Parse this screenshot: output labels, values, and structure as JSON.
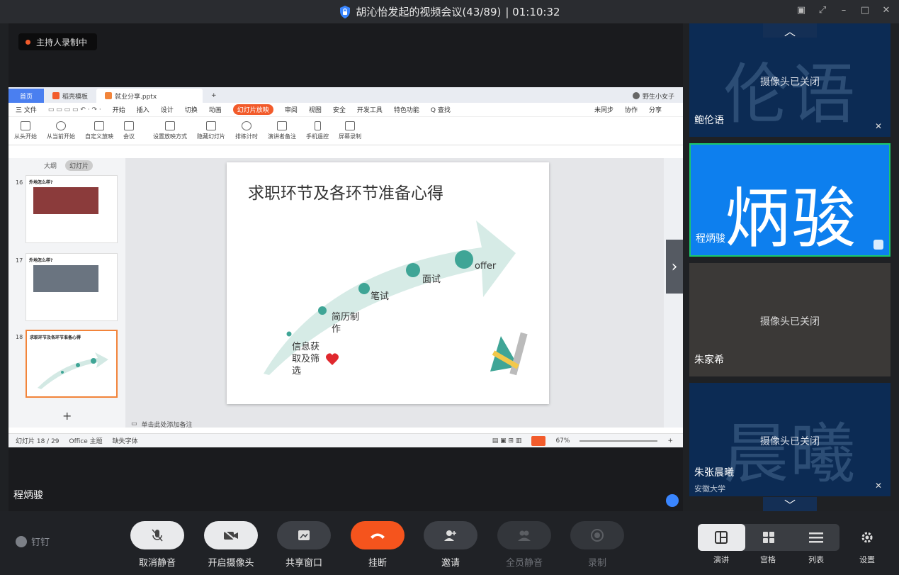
{
  "window": {
    "title": "胡沁怡发起的视频会议(43/89)",
    "timer": "| 01:10:32"
  },
  "recording_badge": "主持人录制中",
  "main_speaker": "程炳骏",
  "wps": {
    "tabs": [
      "首页",
      "稻壳模板",
      "就业分享.pptx"
    ],
    "menu": [
      "三 文件",
      "开始",
      "插入",
      "设计",
      "切换",
      "动画",
      "幻灯片放映",
      "审阅",
      "视图",
      "安全",
      "开发工具",
      "特色功能",
      "Q 查找"
    ],
    "menu_right": [
      "未同步",
      "协作",
      "分享"
    ],
    "ribbon": [
      "从头开始",
      "从当前开始",
      "自定义放映",
      "会议",
      "设置放映方式",
      "隐藏幻灯片",
      "排练计时",
      "演讲者备注",
      "手机遥控",
      "屏幕录制"
    ],
    "user": "野生小女子",
    "panel_tabs": [
      "大纲",
      "幻灯片"
    ],
    "thumbs": [
      {
        "num": "16",
        "title": "外地怎么样?"
      },
      {
        "num": "17",
        "title": "外地怎么样?"
      },
      {
        "num": "18",
        "title": "求职环节及各环节准备心得"
      }
    ],
    "notes_placeholder": "单击此处添加备注",
    "status_left": "幻灯片 18 / 29",
    "status_theme": "Office 主题",
    "status_font": "缺失字体",
    "zoom": "67%"
  },
  "slide": {
    "title": "求职环节及各环节准备心得",
    "steps": [
      "信息获取及筛选",
      "简历制作",
      "笔试",
      "面试",
      "offer"
    ]
  },
  "participants": [
    {
      "bg_text": "伦语",
      "camera": "摄像头已关闭",
      "name": "鲍伦语",
      "style": "dark"
    },
    {
      "bg_text": "炳骏",
      "camera": "",
      "name": "程炳骏",
      "style": "active"
    },
    {
      "bg_text": "",
      "camera": "摄像头已关闭",
      "name": "朱家希",
      "style": "gray"
    },
    {
      "bg_text": "晨曦",
      "camera": "摄像头已关闭",
      "name": "朱张晨曦",
      "sub": "安徽大学",
      "style": "dark"
    }
  ],
  "brand": "钉钉",
  "controls": [
    {
      "label": "取消静音",
      "icon": "mic-off-icon"
    },
    {
      "label": "开启摄像头",
      "icon": "camera-off-icon"
    },
    {
      "label": "共享窗口",
      "icon": "share-window-icon"
    },
    {
      "label": "挂断",
      "icon": "hang-up-icon"
    },
    {
      "label": "邀请",
      "icon": "invite-icon"
    },
    {
      "label": "全员静音",
      "icon": "mute-all-icon"
    },
    {
      "label": "录制",
      "icon": "record-icon"
    }
  ],
  "views": [
    "演讲",
    "宫格",
    "列表"
  ],
  "settings_label": "设置",
  "colors": {
    "accent": "#0d7fee",
    "hangup": "#f5541d",
    "speaker_border": "#1cc86b"
  }
}
